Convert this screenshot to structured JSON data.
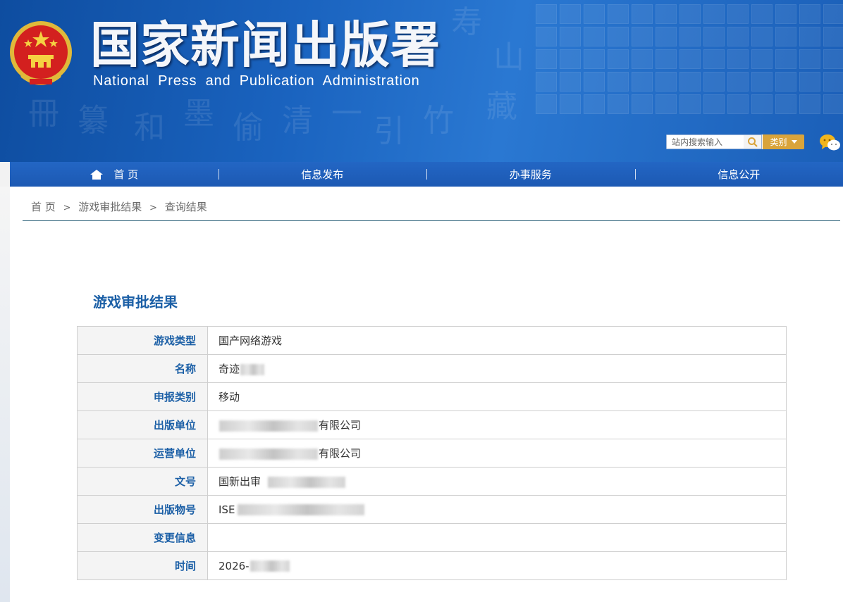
{
  "header": {
    "title_cn": "国家新闻出版署",
    "title_en": "National  Press and Publication Administration",
    "search_placeholder": "站内搜索输入",
    "category_label": "类别",
    "emblem_icon": "national-emblem-icon",
    "wechat_icon": "wechat-icon"
  },
  "nav": {
    "items": [
      {
        "label": "首 页",
        "icon": "home-icon"
      },
      {
        "label": "信息发布"
      },
      {
        "label": "办事服务"
      },
      {
        "label": "信息公开"
      }
    ]
  },
  "breadcrumb": {
    "items": [
      "首 页",
      "游戏审批结果",
      "查询结果"
    ],
    "separator": ">"
  },
  "result": {
    "title": "游戏审批结果",
    "rows": [
      {
        "label": "游戏类型",
        "value": "国产网络游戏"
      },
      {
        "label": "名称",
        "value": "奇迹"
      },
      {
        "label": "申报类别",
        "value": "移动"
      },
      {
        "label": "出版单位",
        "value": "有限公司"
      },
      {
        "label": "运营单位",
        "value": "有限公司"
      },
      {
        "label": "文号",
        "value": "国新出审"
      },
      {
        "label": "出版物号",
        "value": "ISE"
      },
      {
        "label": "变更信息",
        "value": ""
      },
      {
        "label": "时间",
        "value": "2026-"
      }
    ]
  },
  "colors": {
    "banner": "#1a63bf",
    "nav": "#2366c4",
    "accent": "#1b5fa6",
    "category_button": "#d9a43b"
  }
}
